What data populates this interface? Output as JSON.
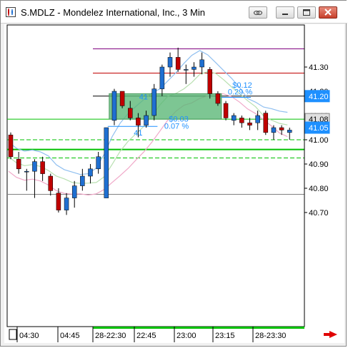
{
  "window": {
    "title": "S.MDLZ - Mondelez International, Inc., 3 Min",
    "buttons": [
      "link-icon",
      "minimize-icon",
      "maximize-icon",
      "close-icon"
    ]
  },
  "chart_data": {
    "type": "candlestick",
    "symbol": "S.MDLZ",
    "interval": "3 Min",
    "price_axis": {
      "ticks": [
        "41.30",
        "41.20",
        "41.10",
        "41.00",
        "40.90",
        "40.80",
        "40.70"
      ],
      "range": [
        40.665,
        41.395
      ]
    },
    "time_axis": {
      "ticks": [
        "04:30",
        "04:45",
        "28-22:30",
        "22:45",
        "23:00",
        "23:15",
        "28-23:30"
      ]
    },
    "price_markers": [
      {
        "label": "41.20",
        "price": 41.18,
        "bg": "#1e90ff",
        "fg": "#ffffff"
      },
      {
        "label": "41.08",
        "price": 41.085,
        "bg": "#e0e0e0",
        "fg": "#000000"
      },
      {
        "label": "41.05",
        "price": 41.05,
        "bg": "#1e90ff",
        "fg": "#ffffff"
      }
    ],
    "candles": [
      {
        "o": 41.02,
        "h": 41.03,
        "l": 40.92,
        "c": 40.93
      },
      {
        "o": 40.92,
        "h": 40.95,
        "l": 40.86,
        "c": 40.88
      },
      {
        "o": 40.87,
        "h": 40.88,
        "l": 40.79,
        "c": 40.87
      },
      {
        "o": 40.87,
        "h": 40.92,
        "l": 40.76,
        "c": 40.91
      },
      {
        "o": 40.91,
        "h": 40.93,
        "l": 40.83,
        "c": 40.86
      },
      {
        "o": 40.85,
        "h": 40.86,
        "l": 40.77,
        "c": 40.79
      },
      {
        "o": 40.78,
        "h": 40.8,
        "l": 40.7,
        "c": 40.71
      },
      {
        "o": 40.71,
        "h": 40.78,
        "l": 40.69,
        "c": 40.76
      },
      {
        "o": 40.76,
        "h": 40.83,
        "l": 40.72,
        "c": 40.81
      },
      {
        "o": 40.81,
        "h": 40.88,
        "l": 40.79,
        "c": 40.85
      },
      {
        "o": 40.85,
        "h": 40.9,
        "l": 40.82,
        "c": 40.88
      },
      {
        "o": 40.88,
        "h": 40.95,
        "l": 40.86,
        "c": 40.93
      },
      {
        "o": 40.76,
        "h": 41.05,
        "l": 40.76,
        "c": 41.05
      },
      {
        "o": 41.08,
        "h": 41.21,
        "l": 41.06,
        "c": 41.2
      },
      {
        "o": 41.2,
        "h": 41.2,
        "l": 41.13,
        "c": 41.14
      },
      {
        "o": 41.13,
        "h": 41.16,
        "l": 41.08,
        "c": 41.09
      },
      {
        "o": 41.09,
        "h": 41.11,
        "l": 41.01,
        "c": 41.06
      },
      {
        "o": 41.06,
        "h": 41.12,
        "l": 41.05,
        "c": 41.1
      },
      {
        "o": 41.1,
        "h": 41.23,
        "l": 41.08,
        "c": 41.21
      },
      {
        "o": 41.21,
        "h": 41.31,
        "l": 41.18,
        "c": 41.3
      },
      {
        "o": 41.3,
        "h": 41.36,
        "l": 41.26,
        "c": 41.34
      },
      {
        "o": 41.34,
        "h": 41.38,
        "l": 41.28,
        "c": 41.29
      },
      {
        "o": 41.29,
        "h": 41.31,
        "l": 41.23,
        "c": 41.29
      },
      {
        "o": 41.29,
        "h": 41.32,
        "l": 41.26,
        "c": 41.3
      },
      {
        "o": 41.3,
        "h": 41.36,
        "l": 41.27,
        "c": 41.33
      },
      {
        "o": 41.29,
        "h": 41.3,
        "l": 41.17,
        "c": 41.19
      },
      {
        "o": 41.19,
        "h": 41.2,
        "l": 41.14,
        "c": 41.15
      },
      {
        "o": 41.15,
        "h": 41.16,
        "l": 41.08,
        "c": 41.09
      },
      {
        "o": 41.08,
        "h": 41.11,
        "l": 41.06,
        "c": 41.1
      },
      {
        "o": 41.09,
        "h": 41.1,
        "l": 41.05,
        "c": 41.07
      },
      {
        "o": 41.07,
        "h": 41.09,
        "l": 41.04,
        "c": 41.06
      },
      {
        "o": 41.07,
        "h": 41.12,
        "l": 41.04,
        "c": 41.1
      },
      {
        "o": 41.11,
        "h": 41.12,
        "l": 41.02,
        "c": 41.03
      },
      {
        "o": 41.03,
        "h": 41.06,
        "l": 41.0,
        "c": 41.05
      },
      {
        "o": 41.05,
        "h": 41.06,
        "l": 41.02,
        "c": 41.04
      },
      {
        "o": 41.03,
        "h": 41.05,
        "l": 41.0,
        "c": 41.04
      }
    ],
    "horizontal_lines": [
      {
        "price": 41.375,
        "color": "#800080",
        "dash": false
      },
      {
        "price": 41.275,
        "color": "#c00000",
        "dash": false
      },
      {
        "price": 41.18,
        "color": "#000000",
        "dash": false
      },
      {
        "price": 41.085,
        "color": "#00c000",
        "dash": false
      },
      {
        "price": 41.0,
        "color": "#00c000",
        "dash": true
      },
      {
        "price": 40.96,
        "color": "#00c000",
        "dash": false,
        "thick": true
      },
      {
        "price": 40.925,
        "color": "#00c000",
        "dash": true
      },
      {
        "price": 40.775,
        "color": "#808080",
        "dash": false
      }
    ],
    "trade_box": {
      "entry_label": "41",
      "exit_label": "41",
      "top_value": "$0.12",
      "top_pct": "0.29 %",
      "bottom_value": "$0.03",
      "bottom_pct": "0.07 %"
    },
    "colors": {
      "up": "#1f6fd1",
      "down": "#c00000",
      "box": "#5cb878"
    }
  }
}
